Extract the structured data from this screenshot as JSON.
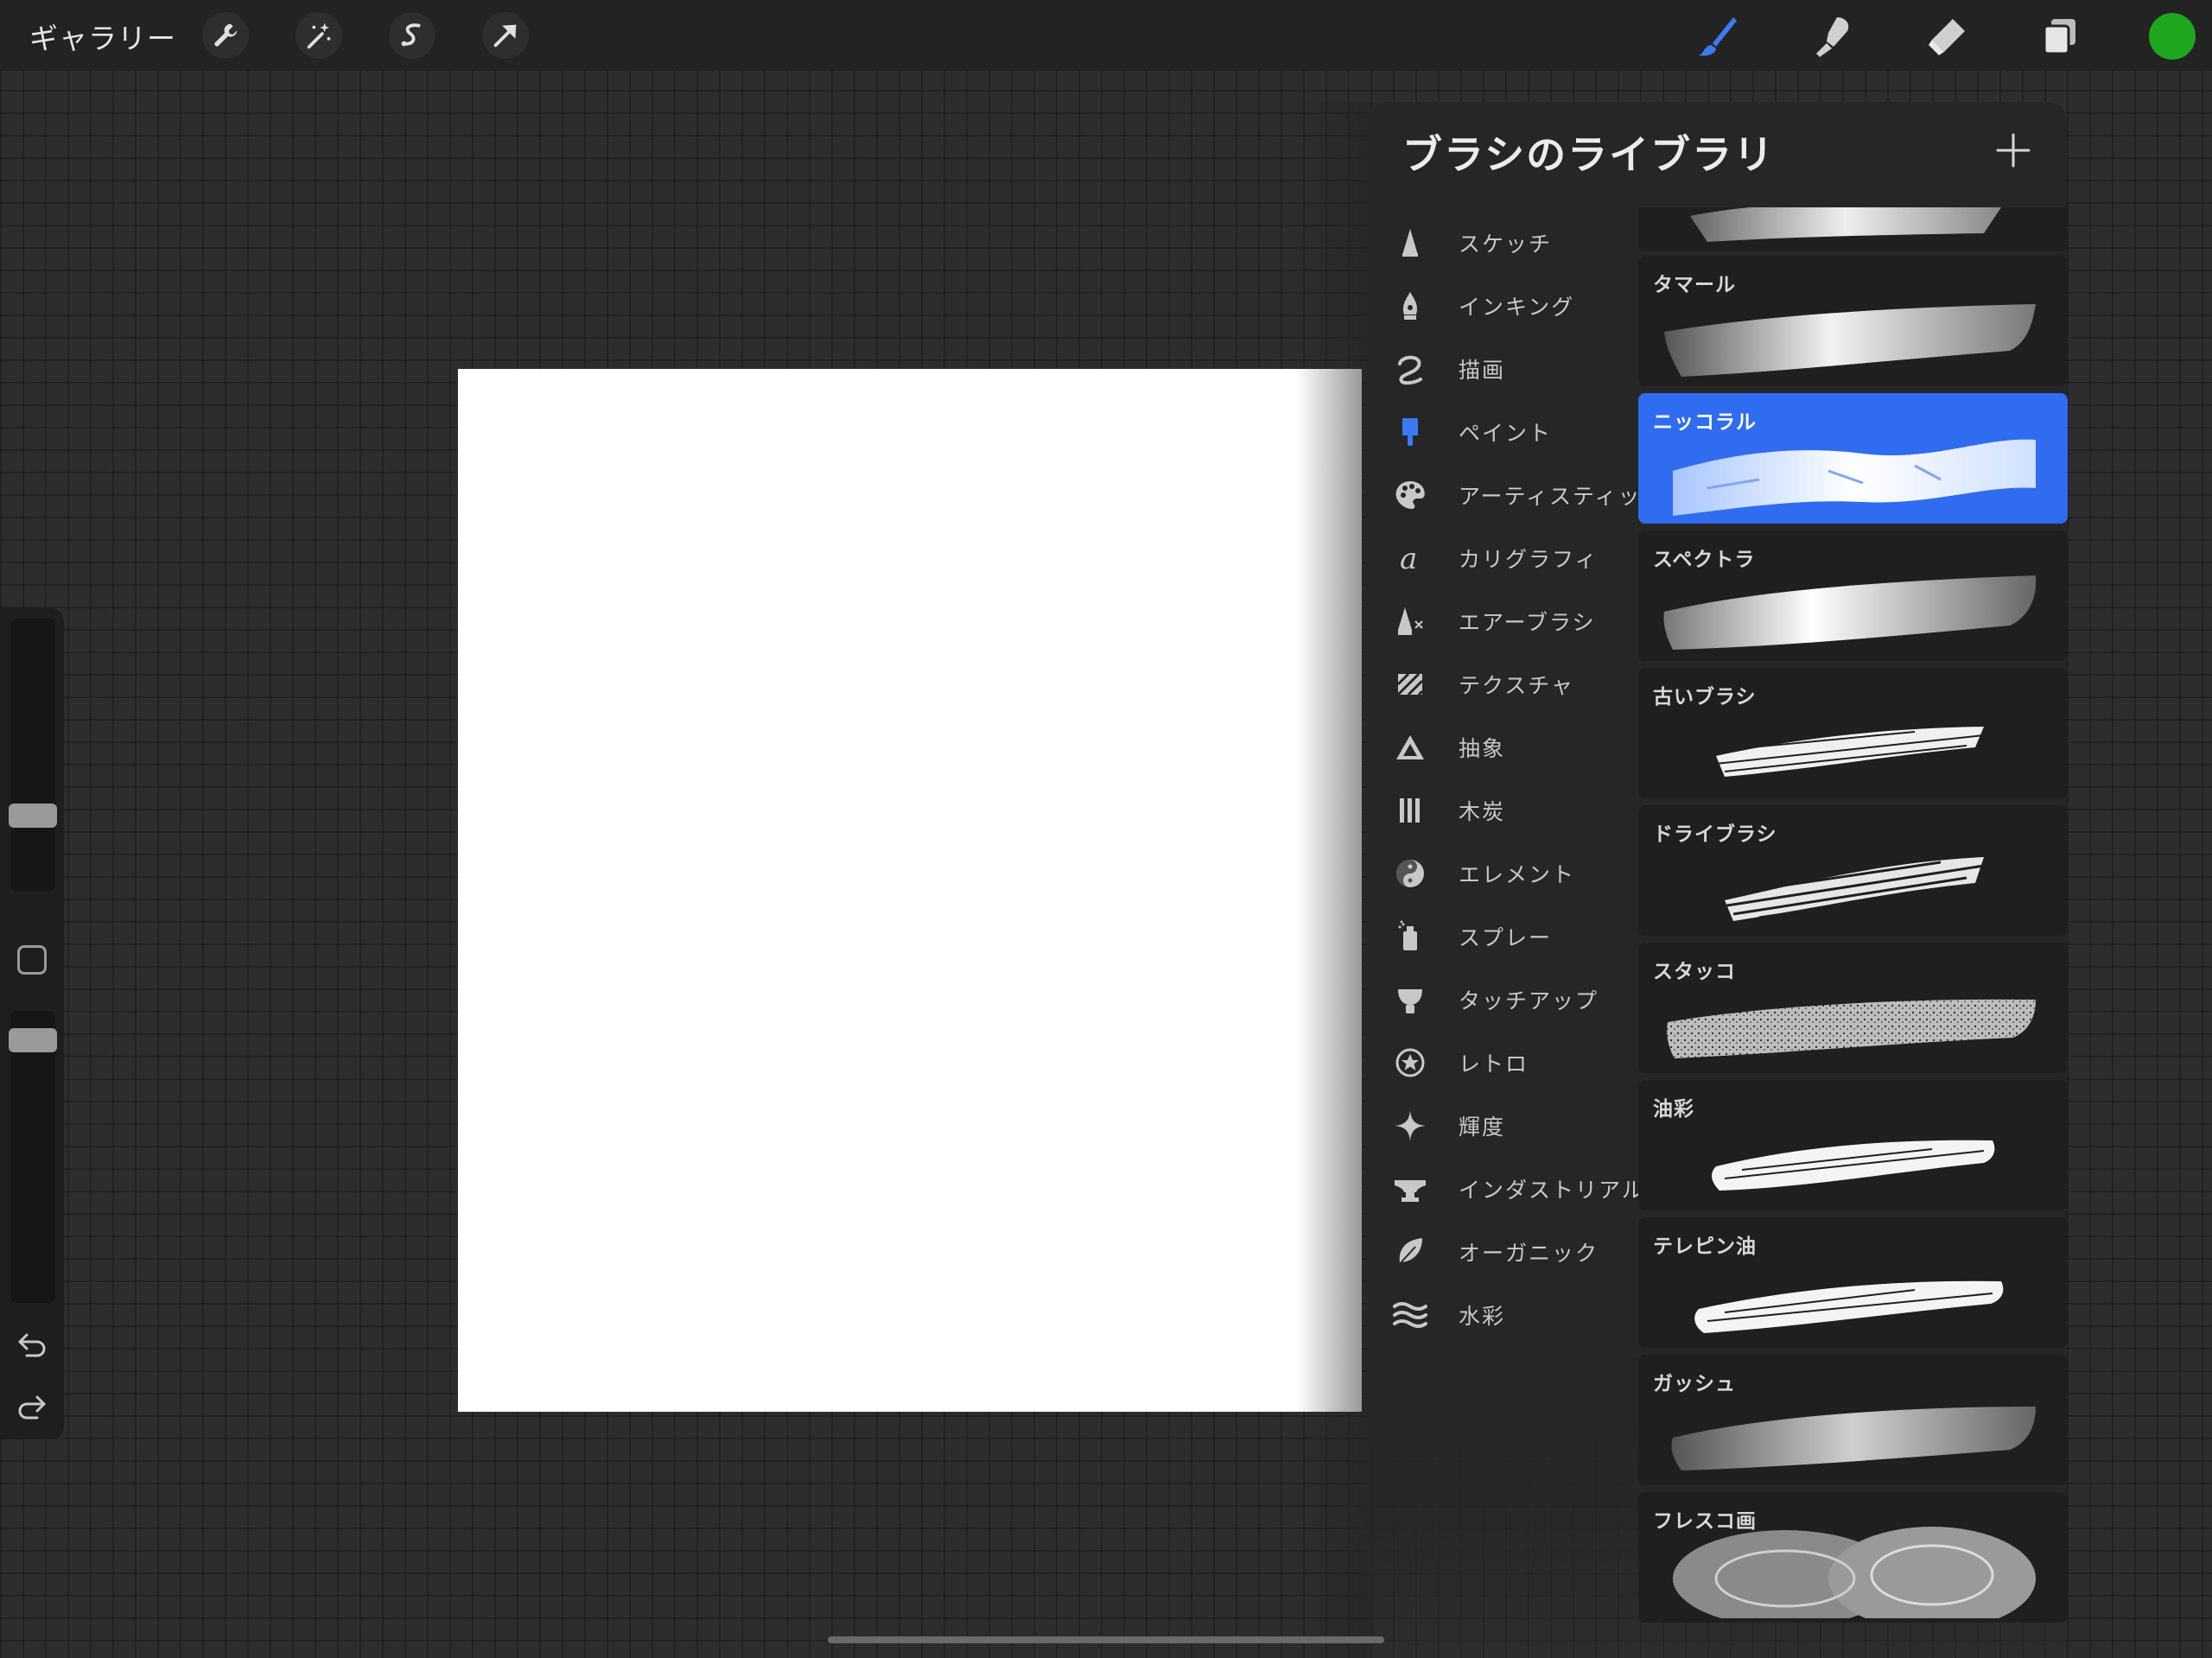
{
  "colors": {
    "accent": "#2f6cf0",
    "active_tool": "#3a7bf5",
    "current_color": "#1fa61f"
  },
  "topbar": {
    "gallery_label": "ギャラリー",
    "left_tools": [
      "wrench-icon",
      "magic-wand-icon",
      "selection-icon",
      "transform-arrow-icon"
    ],
    "right_tools": [
      "brush-icon",
      "smudge-icon",
      "eraser-icon",
      "layers-icon"
    ],
    "active_tool": "brush"
  },
  "sidebar": {
    "brush_size_level": 0.25,
    "opacity_level": 0.95
  },
  "brush_library": {
    "title": "ブラシのライブラリ",
    "categories": [
      {
        "label": "スケッチ",
        "icon": "pencil-tip-icon"
      },
      {
        "label": "インキング",
        "icon": "ink-pen-icon"
      },
      {
        "label": "描画",
        "icon": "squiggle-icon"
      },
      {
        "label": "ペイント",
        "icon": "paint-brush-icon",
        "active": true
      },
      {
        "label": "アーティスティック",
        "icon": "palette-icon"
      },
      {
        "label": "カリグラフィ",
        "icon": "calligraphy-a-icon"
      },
      {
        "label": "エアーブラシ",
        "icon": "airbrush-icon"
      },
      {
        "label": "テクスチャ",
        "icon": "texture-hatch-icon"
      },
      {
        "label": "抽象",
        "icon": "triangle-icon"
      },
      {
        "label": "木炭",
        "icon": "charcoal-sticks-icon"
      },
      {
        "label": "エレメント",
        "icon": "yin-yang-icon"
      },
      {
        "label": "スプレー",
        "icon": "spray-can-icon"
      },
      {
        "label": "タッチアップ",
        "icon": "touchup-icon"
      },
      {
        "label": "レトロ",
        "icon": "star-circle-icon"
      },
      {
        "label": "輝度",
        "icon": "sparkle-icon"
      },
      {
        "label": "インダストリアル",
        "icon": "anvil-icon"
      },
      {
        "label": "オーガニック",
        "icon": "leaf-icon"
      },
      {
        "label": "水彩",
        "icon": "waves-icon"
      }
    ],
    "brushes": [
      {
        "name": ""
      },
      {
        "name": "タマール"
      },
      {
        "name": "ニッコラル",
        "selected": true
      },
      {
        "name": "スペクトラ"
      },
      {
        "name": "古いブラシ"
      },
      {
        "name": "ドライブラシ"
      },
      {
        "name": "スタッコ"
      },
      {
        "name": "油彩"
      },
      {
        "name": "テレピン油"
      },
      {
        "name": "ガッシュ"
      },
      {
        "name": "フレスコ画"
      }
    ]
  }
}
